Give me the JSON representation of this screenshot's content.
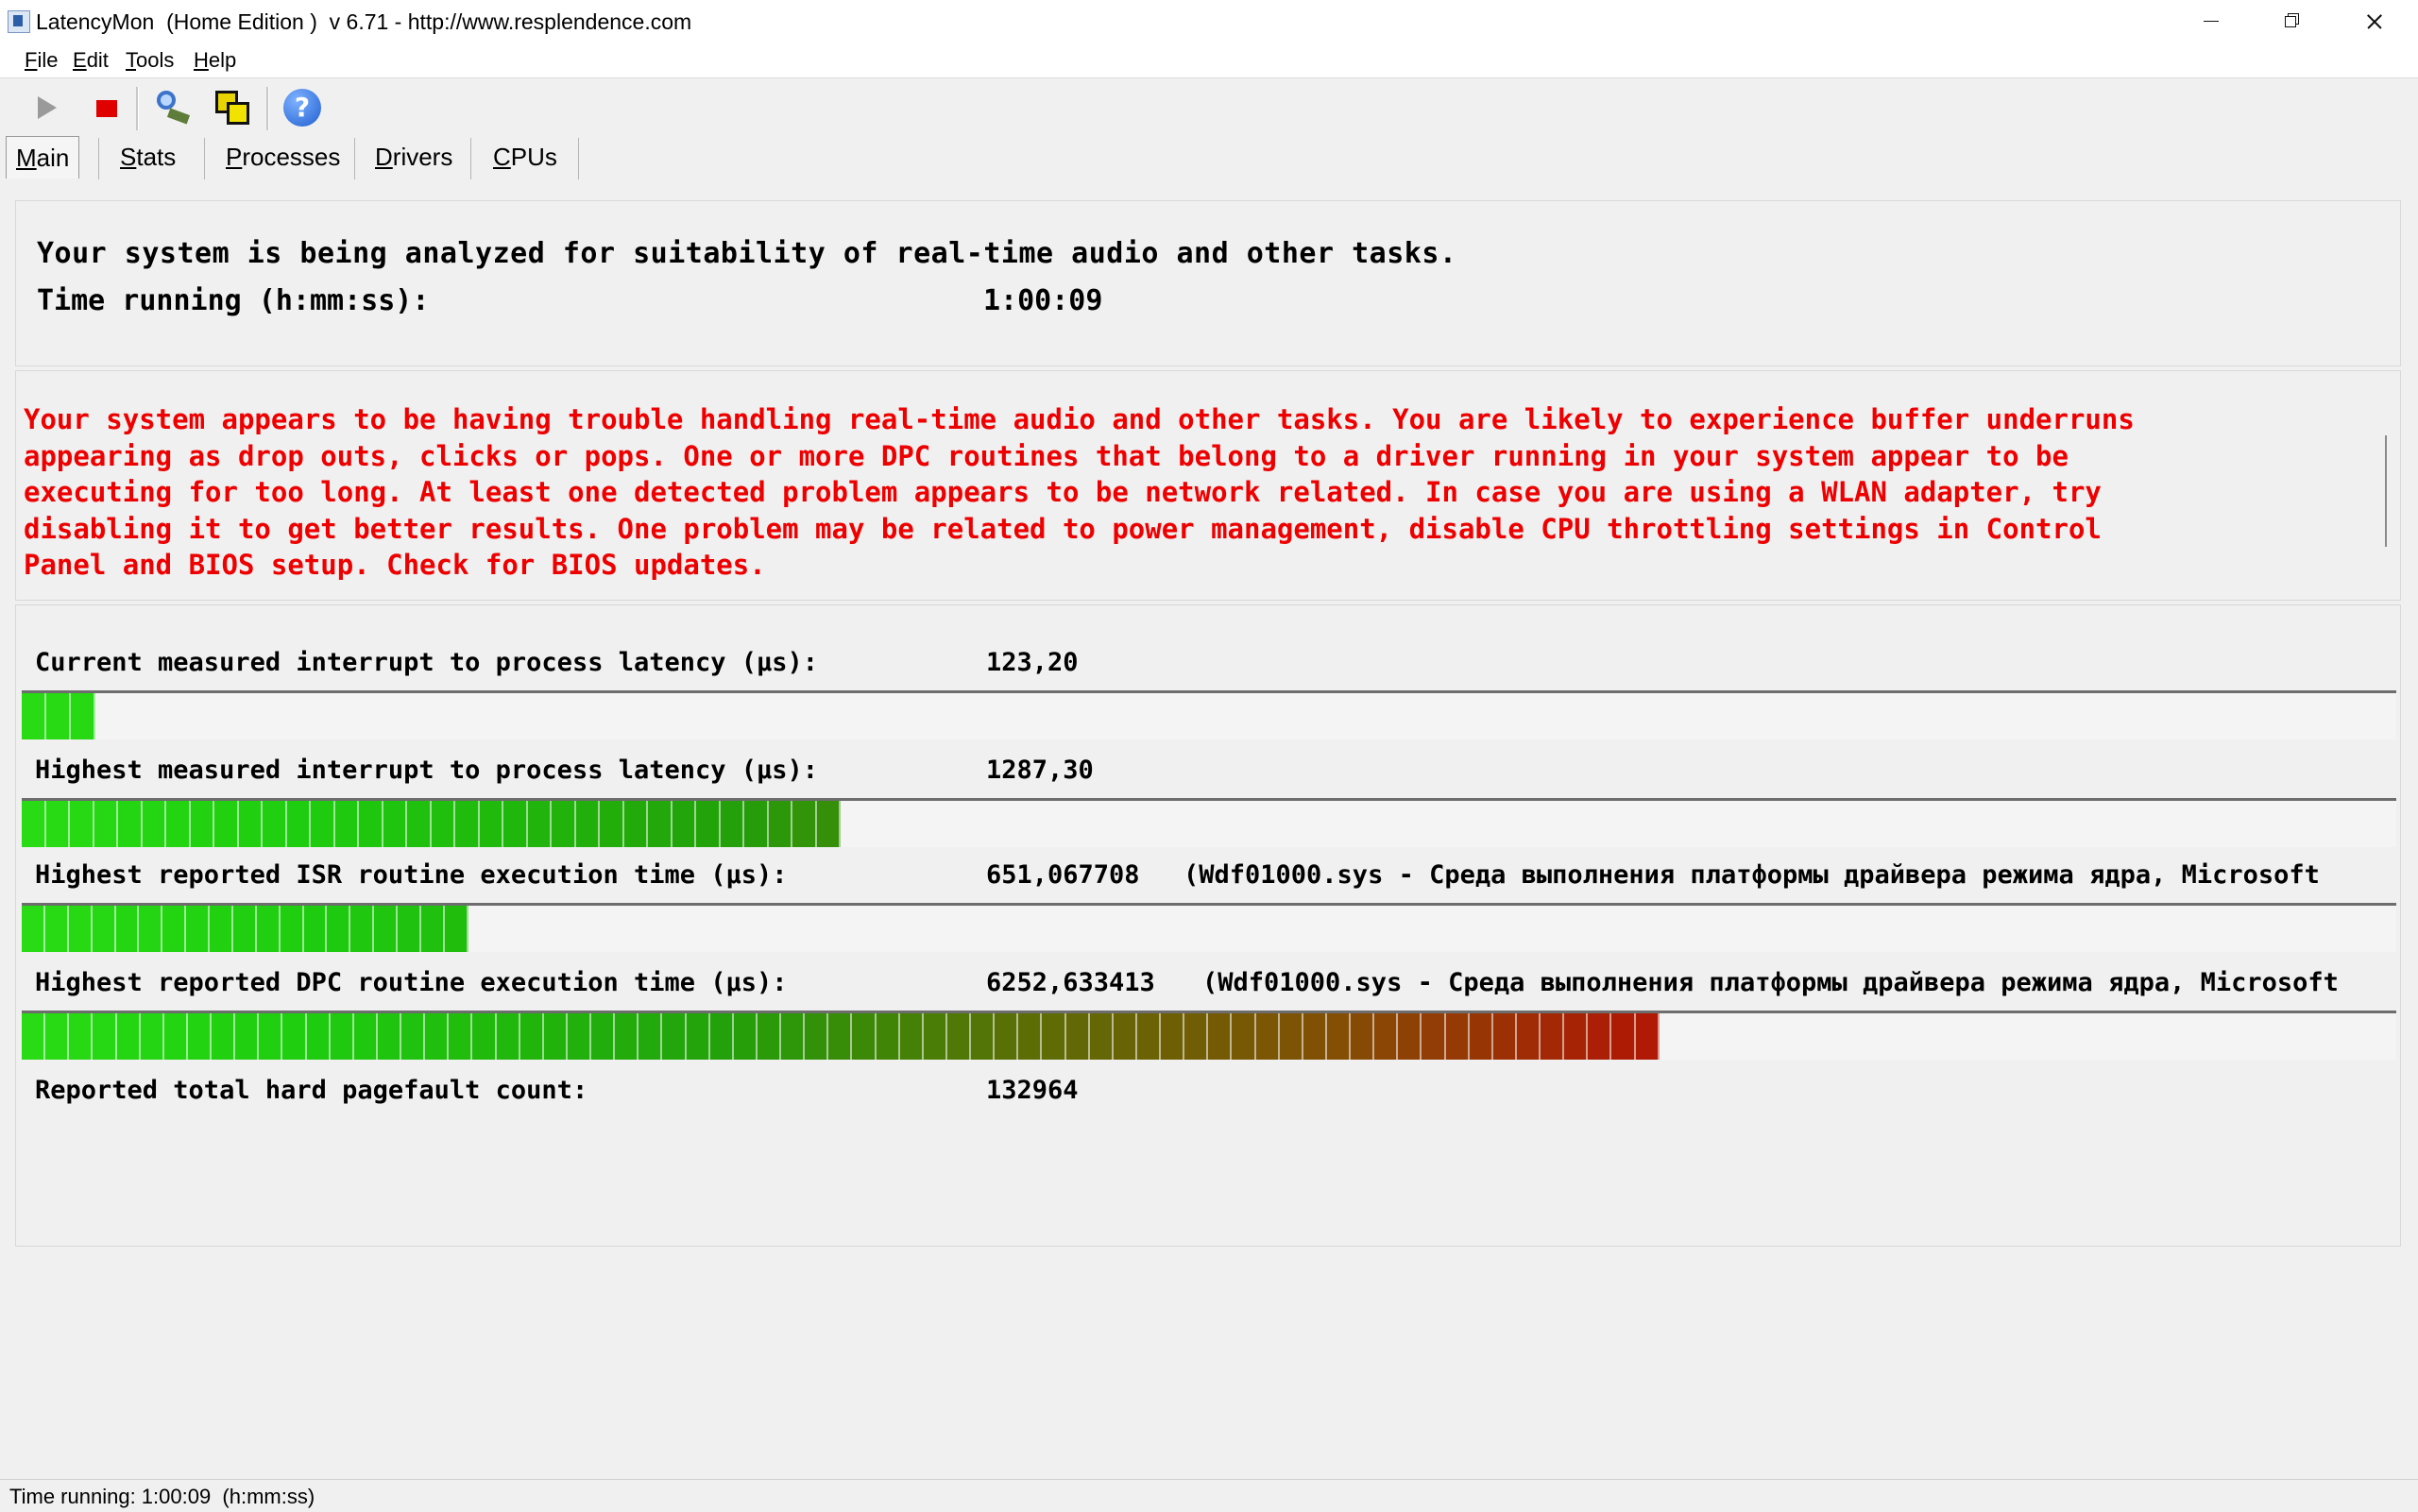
{
  "window": {
    "title": "LatencyMon  (Home Edition )  v 6.71 - http://www.resplendence.com",
    "icon": "latencymon-app-icon"
  },
  "menu": [
    "File",
    "Edit",
    "Tools",
    "Help"
  ],
  "toolbar": {
    "icons": [
      "play-icon",
      "stop-icon",
      "find-icon",
      "windows-icon",
      "help-icon"
    ]
  },
  "tabs": [
    "Main",
    "Stats",
    "Processes",
    "Drivers",
    "CPUs"
  ],
  "status": {
    "heading": "Your system is being analyzed for suitability of real-time audio and other tasks.",
    "time_label": "Time running (h:mm:ss):",
    "time_value": "1:00:09"
  },
  "warning": {
    "lines": [
      "Your system appears to be having trouble handling real-time audio and other tasks. You are likely to experience buffer underruns",
      "appearing as drop outs, clicks or pops. One or more DPC routines that belong to a driver running in your system appear to be",
      "executing for too long. At least one detected problem appears to be network related. In case you are using a WLAN adapter, try",
      "disabling it to get better results. One problem may be related to power management, disable CPU throttling settings in Control",
      "Panel and BIOS setup. Check for BIOS updates."
    ],
    "color": "#ee0000"
  },
  "metrics": [
    {
      "label": "Current measured interrupt to process latency (µs):",
      "value": "123,20",
      "driver": "",
      "bar_fraction": 0.031
    },
    {
      "label": "Highest measured interrupt to process latency (µs):",
      "value": "1287,30",
      "driver": "",
      "bar_fraction": 0.345
    },
    {
      "label": "Highest reported ISR routine execution time (µs):",
      "value": "651,067708",
      "driver": "(Wdf01000.sys - Среда выполнения платформы драйвера режима ядра, Microsoft",
      "bar_fraction": 0.188
    },
    {
      "label": "Highest reported DPC routine execution time (µs):",
      "value": "6252,633413",
      "driver": "(Wdf01000.sys - Среда выполнения платформы драйвера режима ядра, Microsoft",
      "bar_fraction": 0.69
    },
    {
      "label": "Reported total hard pagefault count:",
      "value": "132964",
      "driver": ""
    }
  ],
  "statusbar": {
    "text": "Time running: 1:00:09  (h:mm:ss)"
  }
}
